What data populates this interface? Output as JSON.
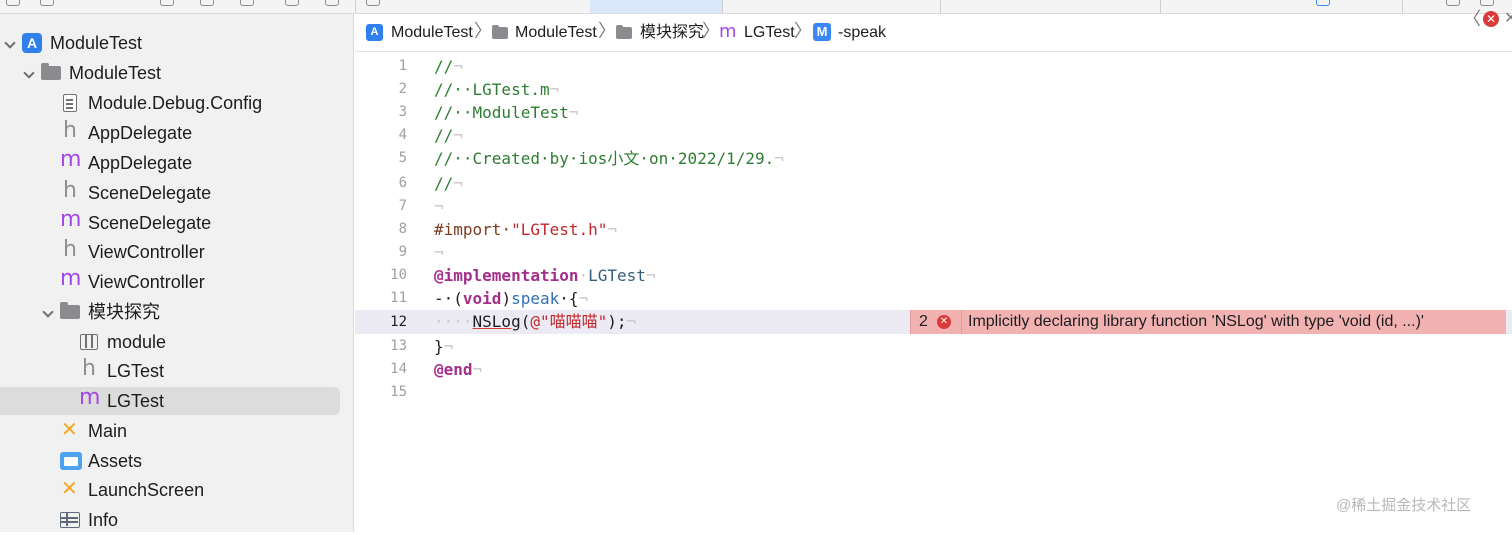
{
  "navigator": {
    "items": [
      {
        "label": "ModuleTest",
        "icon": "xcode-project-icon"
      },
      {
        "label": "ModuleTest",
        "icon": "folder-icon"
      },
      {
        "label": "Module.Debug.Config",
        "icon": "config-file-icon"
      },
      {
        "label": "AppDelegate",
        "icon": "header-file-icon"
      },
      {
        "label": "AppDelegate",
        "icon": "implementation-file-icon"
      },
      {
        "label": "SceneDelegate",
        "icon": "header-file-icon"
      },
      {
        "label": "SceneDelegate",
        "icon": "implementation-file-icon"
      },
      {
        "label": "ViewController",
        "icon": "header-file-icon"
      },
      {
        "label": "ViewController",
        "icon": "implementation-file-icon"
      },
      {
        "label": "模块探究",
        "icon": "folder-icon"
      },
      {
        "label": "module",
        "icon": "modulemap-icon"
      },
      {
        "label": "LGTest",
        "icon": "header-file-icon"
      },
      {
        "label": "LGTest",
        "icon": "implementation-file-icon",
        "selected": true
      },
      {
        "label": "Main",
        "icon": "storyboard-icon"
      },
      {
        "label": "Assets",
        "icon": "assets-icon"
      },
      {
        "label": "LaunchScreen",
        "icon": "storyboard-icon"
      },
      {
        "label": "Info",
        "icon": "plist-icon"
      }
    ],
    "glyphs": {
      "header": "h",
      "implementation": "m",
      "storyboard": "✕",
      "project": "A"
    }
  },
  "jumpbar": {
    "project": "ModuleTest",
    "group": "ModuleTest",
    "subgroup": "模块探究",
    "file": "LGTest",
    "symbol": "-speak",
    "separator": "〉",
    "file_glyph": "m",
    "symbol_glyph": "M",
    "back_glyph": "〈",
    "error_glyph": "✕",
    "close_glyph": "✕"
  },
  "editor": {
    "current_line": 12,
    "lines": [
      {
        "n": "1"
      },
      {
        "n": "2"
      },
      {
        "n": "3"
      },
      {
        "n": "4"
      },
      {
        "n": "5"
      },
      {
        "n": "6"
      },
      {
        "n": "7"
      },
      {
        "n": "8"
      },
      {
        "n": "9"
      },
      {
        "n": "10"
      },
      {
        "n": "11"
      },
      {
        "n": "12"
      },
      {
        "n": "13"
      },
      {
        "n": "14"
      },
      {
        "n": "15"
      }
    ],
    "tokens": {
      "l1": "//",
      "l2": "//··LGTest.m",
      "l3": "//··ModuleTest",
      "l4": "//",
      "l5": "//··Created·by·ios小文·on·2022/1/29.",
      "l6": "//",
      "l8_directive": "#import·",
      "l8_string": "\"LGTest.h\"",
      "l10_keyword": "@implementation",
      "l10_space": "·",
      "l10_class": "LGTest",
      "l11_dash": "-·(",
      "l11_type": "void",
      "l11_close": ")",
      "l11_method": "speak",
      "l11_brace": "·{",
      "l12_indent": "····",
      "l12_func": "NSLog",
      "l12_open": "(",
      "l12_string": "@\"喵喵喵\"",
      "l12_close": ");",
      "l13": "}",
      "l14_keyword": "@end",
      "eol": "¬"
    },
    "error": {
      "count": "2",
      "icon_glyph": "✕",
      "message": "Implicitly declaring library function 'NSLog' with type 'void (id, ...)'"
    }
  },
  "watermark": "@稀土掘金技术社区",
  "colors": {
    "comment": "#2e7d32",
    "keyword": "#a42e8a",
    "string": "#c4262c",
    "error_bg": "#f3b2b2",
    "selection": "#dcdcdc"
  }
}
